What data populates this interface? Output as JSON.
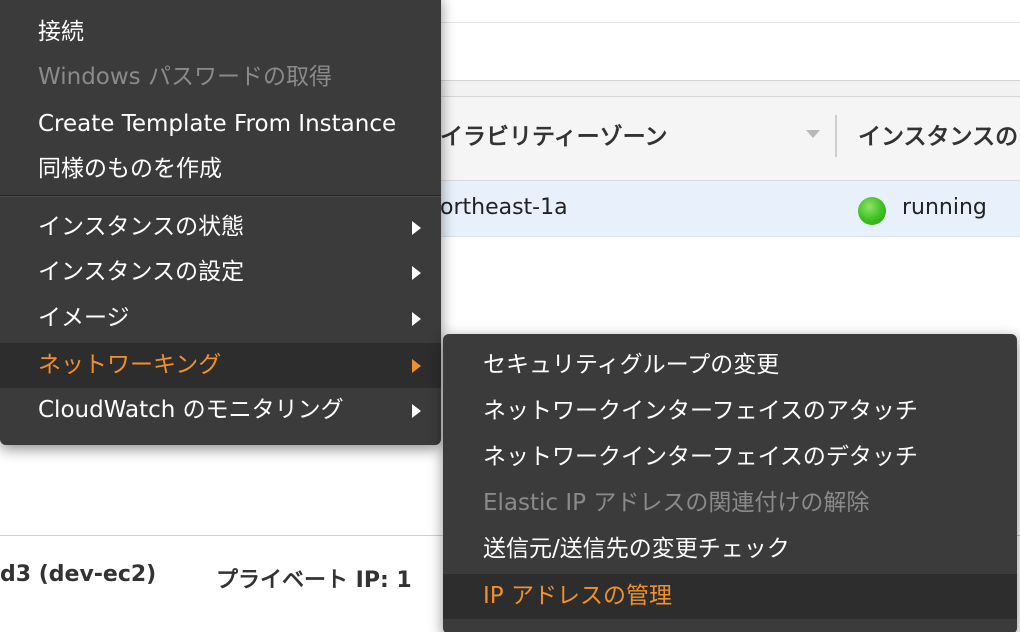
{
  "background": {
    "table": {
      "columns": [
        "イラビリティーゾーン",
        "インスタンスの"
      ],
      "row": {
        "availability_zone": "ortheast-1a",
        "state": "running"
      }
    },
    "details": {
      "instance_name": "d3 (dev-ec2)",
      "private_ip_label": "プライベート IP: 1"
    },
    "colors": {
      "running_dot": "#3cbf1f"
    }
  },
  "context_menu": {
    "items": [
      {
        "label": "接続",
        "disabled": false
      },
      {
        "label": "Windows パスワードの取得",
        "disabled": true
      },
      {
        "label": "Create Template From Instance",
        "disabled": false
      },
      {
        "label": "同様のものを作成",
        "disabled": false
      },
      {
        "label": "インスタンスの状態",
        "has_submenu": true
      },
      {
        "label": "インスタンスの設定",
        "has_submenu": true
      },
      {
        "label": "イメージ",
        "has_submenu": true
      },
      {
        "label": "ネットワーキング",
        "has_submenu": true,
        "active": true
      },
      {
        "label": "CloudWatch のモニタリング",
        "has_submenu": true
      }
    ],
    "arrow_icon": "chevron-right-icon",
    "colors": {
      "background": "#3b3b3b",
      "active_text": "#f0902d",
      "disabled_text": "#8a8a8a"
    }
  },
  "submenu": {
    "parent": "ネットワーキング",
    "items": [
      {
        "label": "セキュリティグループの変更",
        "disabled": false
      },
      {
        "label": "ネットワークインターフェイスのアタッチ",
        "disabled": false
      },
      {
        "label": "ネットワークインターフェイスのデタッチ",
        "disabled": false
      },
      {
        "label": "Elastic IP アドレスの関連付けの解除",
        "disabled": true
      },
      {
        "label": "送信元/送信先の変更チェック",
        "disabled": false
      },
      {
        "label": "IP アドレスの管理",
        "disabled": false,
        "active": true
      }
    ]
  }
}
